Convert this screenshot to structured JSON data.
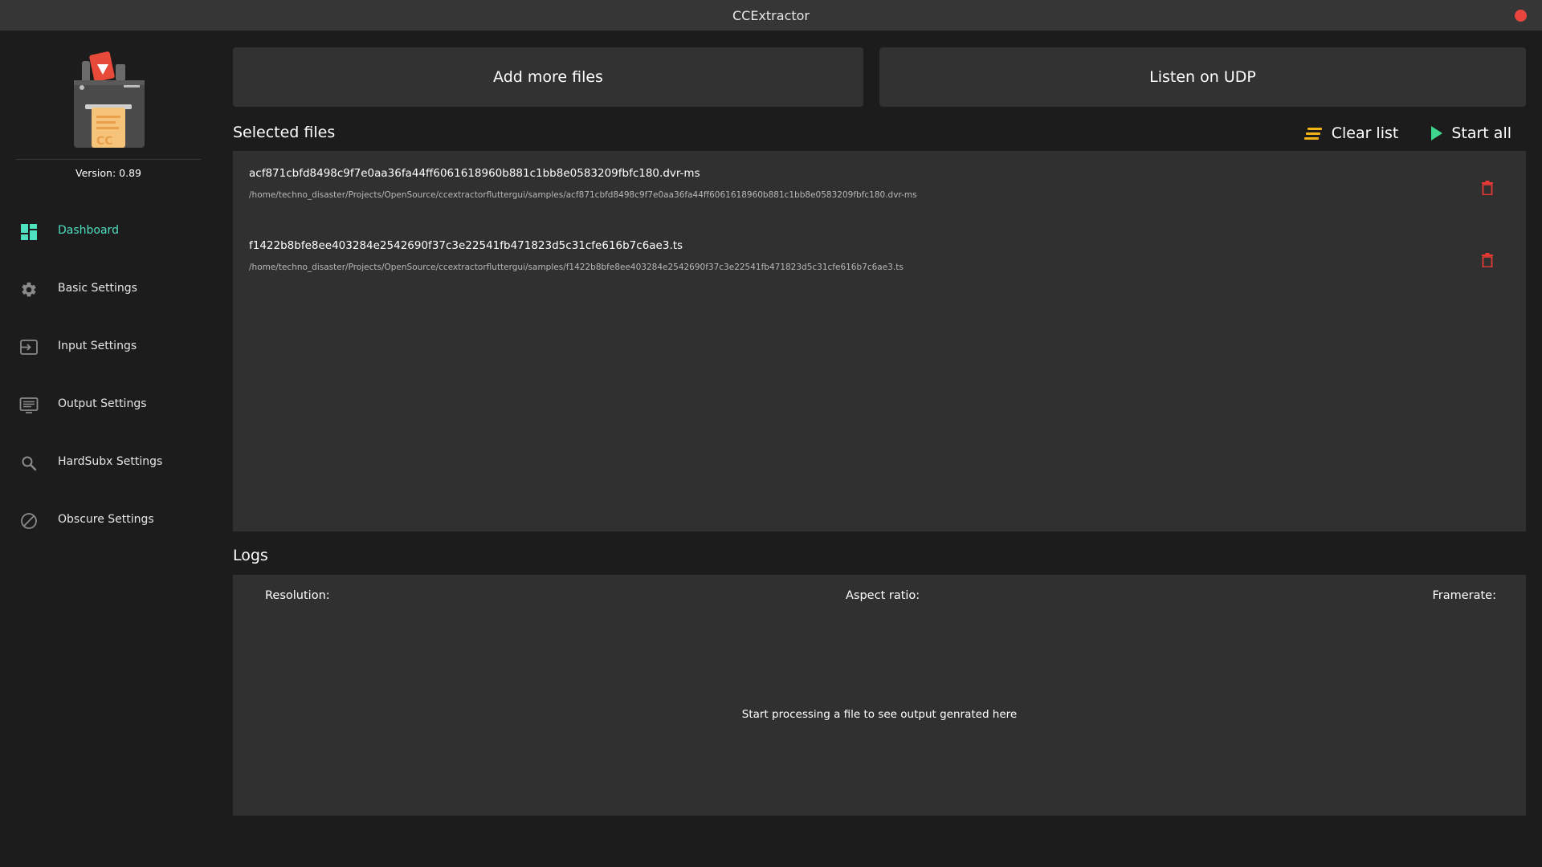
{
  "window": {
    "title": "CCExtractor"
  },
  "sidebar": {
    "version": "Version: 0.89",
    "items": [
      {
        "label": "Dashboard",
        "icon": "dashboard-icon",
        "active": true
      },
      {
        "label": "Basic Settings",
        "icon": "gear-icon",
        "active": false
      },
      {
        "label": "Input Settings",
        "icon": "input-icon",
        "active": false
      },
      {
        "label": "Output Settings",
        "icon": "output-icon",
        "active": false
      },
      {
        "label": "HardSubx Settings",
        "icon": "search-icon",
        "active": false
      },
      {
        "label": "Obscure Settings",
        "icon": "block-icon",
        "active": false
      }
    ]
  },
  "actions": {
    "add_files": "Add more files",
    "listen_udp": "Listen on UDP",
    "clear_list": "Clear list",
    "start_all": "Start all"
  },
  "files": {
    "title": "Selected files",
    "items": [
      {
        "name": "acf871cbfd8498c9f7e0aa36fa44ff6061618960b881c1bb8e0583209fbfc180.dvr-ms",
        "path": "/home/techno_disaster/Projects/OpenSource/ccextractorfluttergui/samples/acf871cbfd8498c9f7e0aa36fa44ff6061618960b881c1bb8e0583209fbfc180.dvr-ms"
      },
      {
        "name": "f1422b8bfe8ee403284e2542690f37c3e22541fb471823d5c31cfe616b7c6ae3.ts",
        "path": "/home/techno_disaster/Projects/OpenSource/ccextractorfluttergui/samples/f1422b8bfe8ee403284e2542690f37c3e22541fb471823d5c31cfe616b7c6ae3.ts"
      }
    ]
  },
  "logs": {
    "title": "Logs",
    "resolution_label": "Resolution:",
    "aspect_label": "Aspect ratio:",
    "framerate_label": "Framerate:",
    "empty_message": "Start processing a file to see output genrated here"
  },
  "colors": {
    "accent": "#4fe0c0",
    "clear_icon": "#f2b515",
    "start_icon": "#3dd68c",
    "delete_icon": "#e53935",
    "close_dot": "#e8463d"
  }
}
